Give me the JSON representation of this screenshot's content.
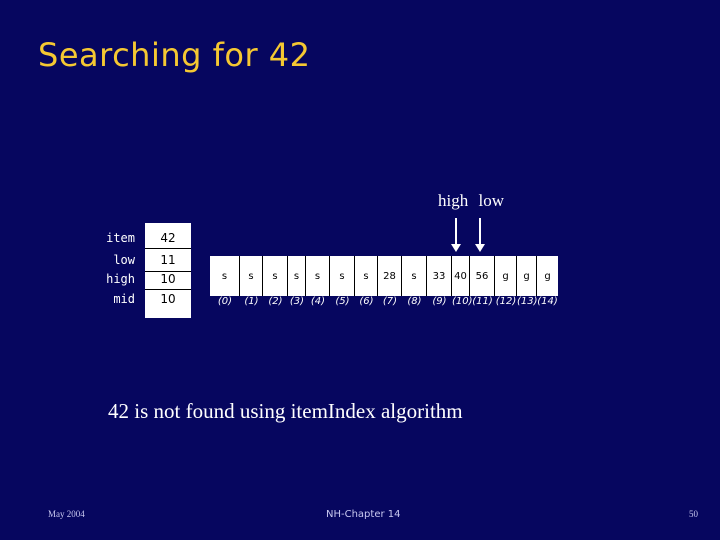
{
  "slide": {
    "title": "Searching for 42",
    "message": "42 is not found using itemIndex algorithm",
    "title_color": "#f5c832",
    "background_color": "#06065f"
  },
  "pointers": {
    "high_label": "high",
    "low_label": "low"
  },
  "variables": [
    {
      "name": "item",
      "value": "42"
    },
    {
      "name": "low",
      "value": "11"
    },
    {
      "name": "high",
      "value": "10"
    },
    {
      "name": "mid",
      "value": "10"
    }
  ],
  "array": {
    "cells": [
      "s",
      "s",
      "s",
      "s",
      "s",
      "s",
      "s",
      "28",
      "s",
      "33",
      "40",
      "56",
      "g",
      "g",
      "g"
    ],
    "indices": [
      "(0)",
      "(1)",
      "(2)",
      "(3)",
      "(4)",
      "(5)",
      "(6)",
      "(7)",
      "(8)",
      "(9)",
      "(10)",
      "(11)",
      "(12)",
      "(13)",
      "(14)"
    ]
  },
  "footer": {
    "date": "May 2004",
    "chapter": "NH-Chapter 14",
    "page": "50"
  }
}
